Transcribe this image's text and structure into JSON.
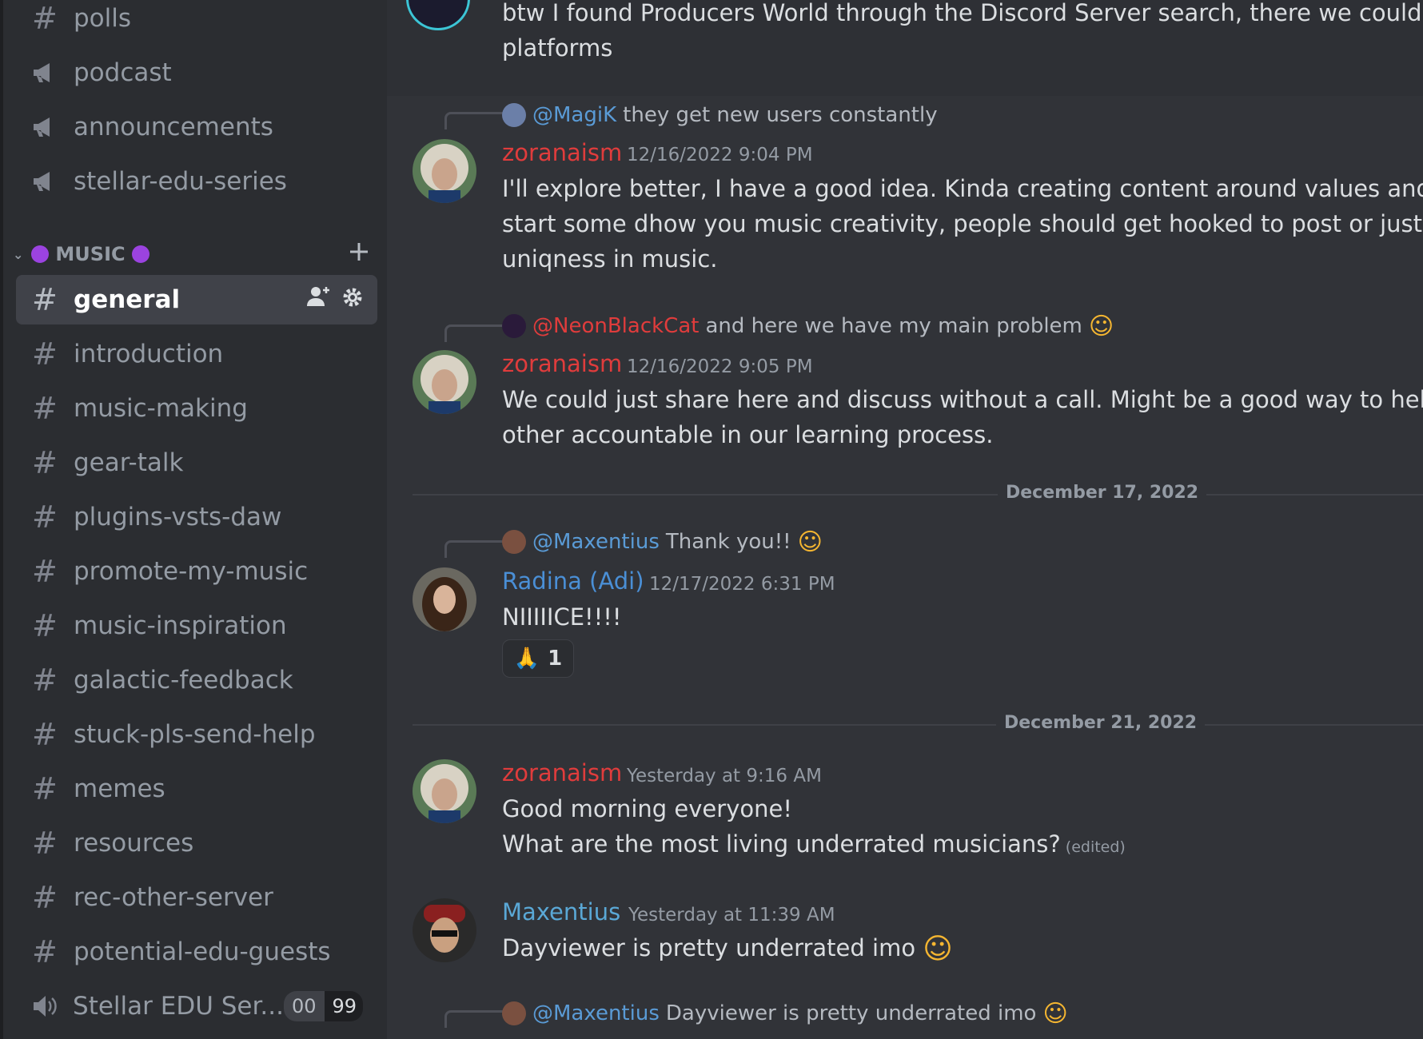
{
  "sidebar": {
    "channels_top": [
      {
        "label": "polls",
        "icon": "hash-icon"
      },
      {
        "label": "podcast",
        "icon": "announcement-icon"
      },
      {
        "label": "announcements",
        "icon": "announcement-icon"
      },
      {
        "label": "stellar-edu-series",
        "icon": "announcement-icon"
      }
    ],
    "category": {
      "label": "MUSIC",
      "dot_color": "#9b43e0"
    },
    "channels": [
      {
        "label": "general",
        "active": true
      },
      {
        "label": "introduction"
      },
      {
        "label": "music-making"
      },
      {
        "label": "gear-talk"
      },
      {
        "label": "plugins-vsts-daw"
      },
      {
        "label": "promote-my-music"
      },
      {
        "label": "music-inspiration"
      },
      {
        "label": "galactic-feedback"
      },
      {
        "label": "stuck-pls-send-help"
      },
      {
        "label": "memes"
      },
      {
        "label": "resources"
      },
      {
        "label": "rec-other-server"
      },
      {
        "label": "potential-edu-guests"
      }
    ],
    "voice_channel": {
      "label": "Stellar EDU Ser...",
      "count_a": "00",
      "count_b": "99"
    }
  },
  "chat": {
    "top_message": {
      "line1": "btw I found Producers World through the Discord Server search, there we could also a",
      "line2": "platforms"
    },
    "messages": [
      {
        "reply_mention": "@MagiK",
        "reply_text": "they get new users constantly",
        "author": "zoranaism",
        "timestamp": "12/16/2022 9:04 PM",
        "lines": [
          "I'll explore better, I have a good idea. Kinda creating content around values and ours is",
          "start some dhow you music creativity, people should get hooked to post or just discus",
          "uniqness in music."
        ]
      },
      {
        "reply_mention": "@NeonBlackCat",
        "reply_text": "and here we have my main problem",
        "author": "zoranaism",
        "timestamp": "12/16/2022 9:05 PM",
        "lines": [
          "We could just share here and discuss without a call. Might be a good way to help each",
          "other accountable in our learning process."
        ]
      },
      {
        "reply_mention": "@Maxentius",
        "reply_text": "Thank you!!",
        "author": "Radina (Adi)",
        "timestamp": "12/17/2022 6:31 PM",
        "lines": [
          "NIIIIICE!!!!"
        ],
        "reaction": {
          "emoji": "🙏",
          "count": "1"
        }
      },
      {
        "author": "zoranaism",
        "timestamp": "Yesterday at 9:16 AM",
        "lines": [
          "Good morning everyone!",
          "What are the most living underrated musicians?"
        ],
        "edited": "(edited)"
      },
      {
        "author": "Maxentius",
        "timestamp": "Yesterday at 11:39 AM",
        "lines": [
          "Dayviewer is pretty underrated imo"
        ]
      },
      {
        "reply_mention": "@Maxentius",
        "reply_text": "Dayviewer is pretty underrated imo"
      }
    ],
    "dividers": [
      "December 17, 2022",
      "December 21, 2022"
    ]
  },
  "colors": {
    "zoranaism": "#e03c3c",
    "radina": "#4a8fd6",
    "maxentius": "#5aa8d6",
    "mention_magik": "#5a9bd6",
    "mention_neon": "#e03c3c",
    "mention_max": "#5a9bd6"
  }
}
